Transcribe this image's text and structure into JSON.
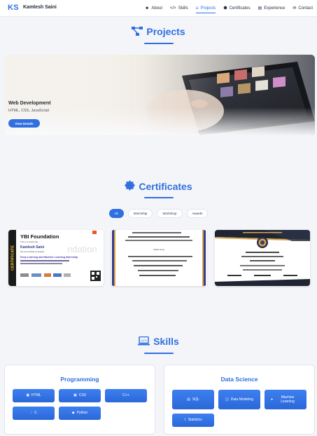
{
  "brand": {
    "mark": "KS",
    "name": "Kamlesh Saini"
  },
  "nav": [
    {
      "icon": "user-icon",
      "glyph": "☻",
      "label": "About",
      "active": false
    },
    {
      "icon": "code-icon",
      "glyph": "</>",
      "label": "Skills",
      "active": false
    },
    {
      "icon": "project-diagram-icon",
      "glyph": "⩍",
      "label": "Projects",
      "active": true
    },
    {
      "icon": "certificate-icon",
      "glyph": "⬢",
      "label": "Certificates",
      "active": false
    },
    {
      "icon": "briefcase-icon",
      "glyph": "▤",
      "label": "Experience",
      "active": false
    },
    {
      "icon": "envelope-icon",
      "glyph": "✉",
      "label": "Contact",
      "active": false
    }
  ],
  "projects": {
    "title": "Projects",
    "card": {
      "title": "Web Development",
      "tech": "HTML, CSS, JavaScript",
      "button": "View Details"
    }
  },
  "certificates": {
    "title": "Certificates",
    "filters": [
      "All",
      "Internship",
      "Workshop",
      "Awards"
    ],
    "active_filter": "All",
    "cert1": {
      "side_text": "CERTIFICATE",
      "org": "YBI Foundation",
      "line1": "This is to certify that",
      "name": "Kamlesh Saini",
      "line2": "has successfully completed",
      "course": "Deep Learning and Machine Learning Internship",
      "watermark": "ndation"
    },
    "cert2": {
      "line1": "TATA Sons"
    }
  },
  "skills": {
    "title": "Skills",
    "programming": {
      "title": "Programming",
      "items": [
        "HTML",
        "CSS",
        "C++",
        "C",
        "Python"
      ]
    },
    "data_science": {
      "title": "Data Science",
      "items": [
        "SQL",
        "Data Modeling",
        "Machine Learning",
        "Statistics"
      ]
    }
  },
  "colors": {
    "accent": "#2f6fe0",
    "background": "#f4f5f9",
    "card": "#ffffff"
  }
}
